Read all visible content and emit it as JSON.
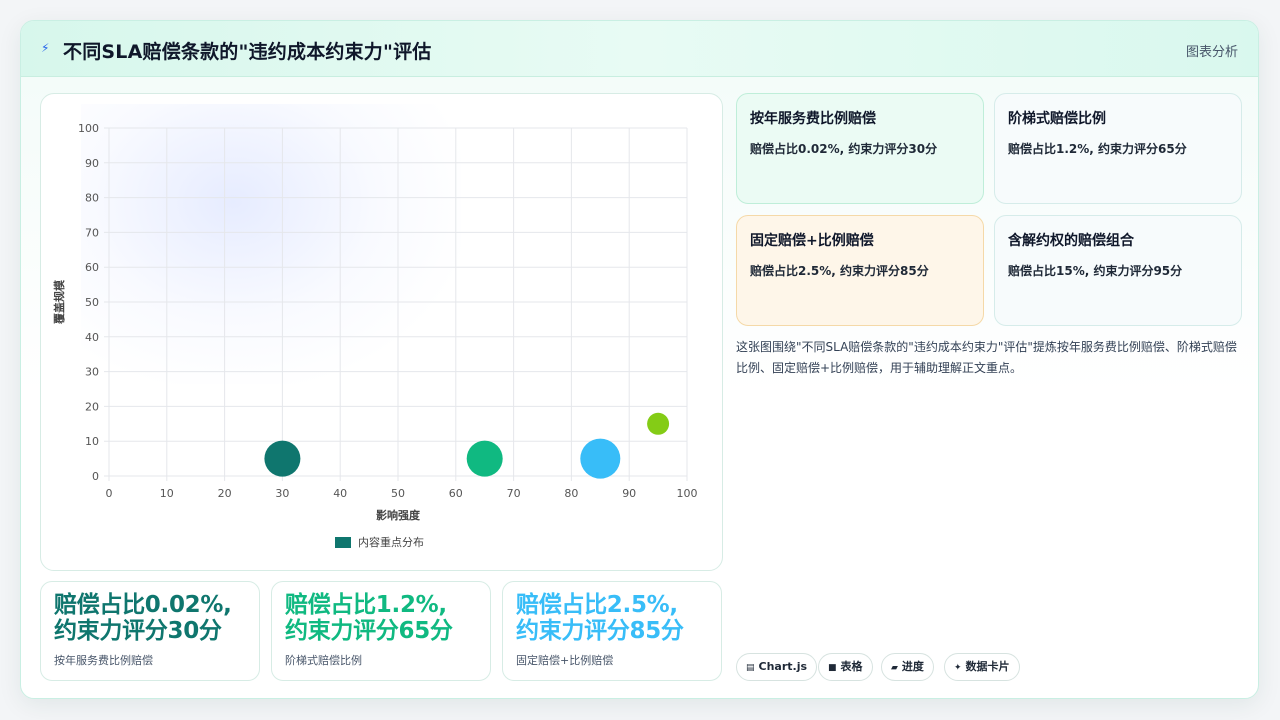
{
  "header": {
    "icon": "lightning-icon",
    "title": "不同SLA赔偿条款的\"违约成本约束力\"评估",
    "tag": "图表分析"
  },
  "chart_data": {
    "type": "scatter",
    "subtype": "bubble",
    "xlabel": "影响强度",
    "ylabel": "覆盖规模",
    "xlim": [
      0,
      100
    ],
    "ylim": [
      0,
      100
    ],
    "x_ticks": [
      0,
      10,
      20,
      30,
      40,
      50,
      60,
      70,
      80,
      90,
      100
    ],
    "y_ticks": [
      0,
      10,
      20,
      30,
      40,
      50,
      60,
      70,
      80,
      90,
      100
    ],
    "grid": true,
    "legend": {
      "position": "bottom",
      "label": "内容重点分布",
      "color": "#0f766e"
    },
    "series": [
      {
        "name": "内容重点分布",
        "points": [
          {
            "x": 30,
            "y": 5,
            "r": 18,
            "color": "#0f766e"
          },
          {
            "x": 65,
            "y": 5,
            "r": 18,
            "color": "#10b981"
          },
          {
            "x": 85,
            "y": 5,
            "r": 20,
            "color": "#38bdf8"
          },
          {
            "x": 95,
            "y": 15,
            "r": 11,
            "color": "#84cc16"
          }
        ]
      }
    ]
  },
  "stats": [
    {
      "big": "赔偿占比0.02%，约束力评分30分",
      "line1": "赔偿占比0.02%,",
      "line2": "约束力评分30分",
      "small": "按年服务费比例赔偿",
      "color": "#0f766e"
    },
    {
      "big": "赔偿占比1.2%，约束力评分65分",
      "line1": "赔偿占比1.2%,",
      "line2": "约束力评分65分",
      "small": "阶梯式赔偿比例",
      "color": "#10b981"
    },
    {
      "big": "赔偿占比2.5%，约束力评分85分",
      "line1": "赔偿占比2.5%,",
      "line2": "约束力评分85分",
      "small": "固定赔偿+比例赔偿",
      "color": "#38bdf8"
    }
  ],
  "info_cards": [
    {
      "title": "按年服务费比例赔偿",
      "desc": "赔偿占比0.02%, 约束力评分30分",
      "bg": "#ebfbf4",
      "border": "#bfeed9"
    },
    {
      "title": "阶梯式赔偿比例",
      "desc": "赔偿占比1.2%, 约束力评分65分",
      "bg": "#f7fbfc",
      "border": "#d6ecea"
    },
    {
      "title": "固定赔偿+比例赔偿",
      "desc": "赔偿占比2.5%, 约束力评分85分",
      "bg": "#fef6e9",
      "border": "#f5d9a8"
    },
    {
      "title": "含解约权的赔偿组合",
      "desc": "赔偿占比15%, 约束力评分95分",
      "bg": "#f7fbfc",
      "border": "#d6ecea"
    }
  ],
  "summary": "这张图围绕\"不同SLA赔偿条款的\"违约成本约束力\"评估\"提炼按年服务费比例赔偿、阶梯式赔偿比例、固定赔偿+比例赔偿，用于辅助理解正文重点。",
  "pills": [
    {
      "icon": "chart-icon",
      "glyph": "▤",
      "label": "Chart.js"
    },
    {
      "icon": "table-icon",
      "glyph": "■",
      "label": "表格"
    },
    {
      "icon": "progress-icon",
      "glyph": "▰",
      "label": "进度"
    },
    {
      "icon": "sparkle-icon",
      "glyph": "✦",
      "label": "数据卡片"
    }
  ]
}
